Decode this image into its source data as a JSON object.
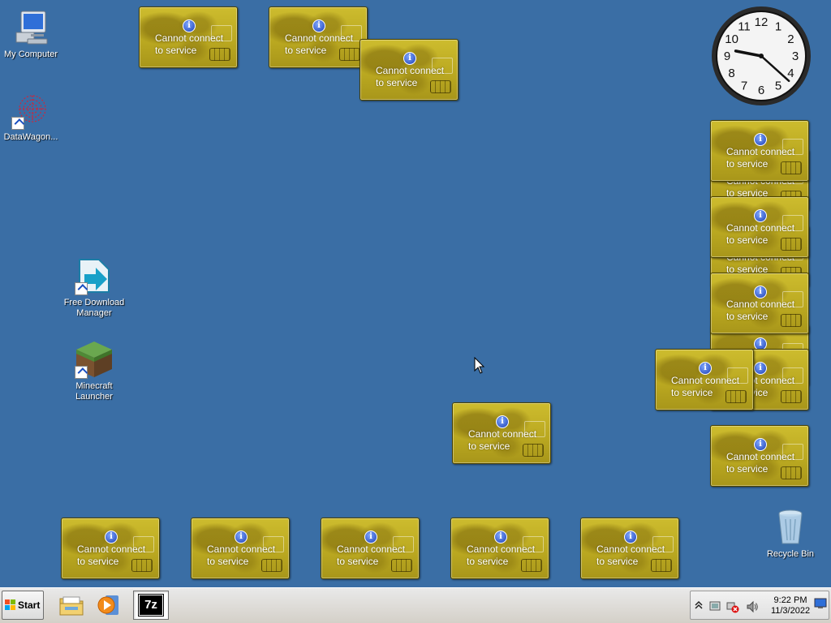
{
  "desktop_icons": [
    {
      "label": "My Computer"
    },
    {
      "label": "DataWagon..."
    },
    {
      "label": "Free Download Manager"
    },
    {
      "label": "Minecraft Launcher"
    },
    {
      "label": "Recycle Bin"
    }
  ],
  "gadget": {
    "info_glyph": "i",
    "line1": "Cannot connect",
    "line2": "to service"
  },
  "clock_gadget": {
    "numerals": [
      "12",
      "1",
      "2",
      "3",
      "4",
      "5",
      "6",
      "7",
      "8",
      "9",
      "10",
      "11"
    ],
    "hour": 9,
    "minute": 22
  },
  "taskbar": {
    "start_label": "Start",
    "seven_zip_label": "7z",
    "tray": {
      "time": "9:22 PM",
      "date": "11/3/2022"
    }
  },
  "colors": {
    "desktop": "#3a6ea5",
    "gadget_gold": "#c2b02a"
  }
}
